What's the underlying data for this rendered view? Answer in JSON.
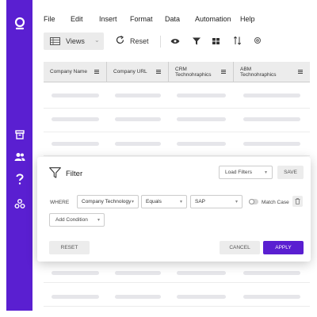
{
  "colors": {
    "brand": "#5a1fd1",
    "header_bg": "#ececec",
    "skeleton": "#e6e6ea"
  },
  "sidebar": {
    "logo_icon": "logo-icon",
    "items": [
      {
        "icon": "archive-icon"
      },
      {
        "icon": "users-icon"
      },
      {
        "icon": "help-icon"
      },
      {
        "icon": "integrations-icon"
      }
    ]
  },
  "menu": [
    "File",
    "Edit",
    "Insert",
    "Format",
    "Data",
    "Automation",
    "Help"
  ],
  "toolbar": {
    "views_label": "Views",
    "reset_label": "Reset",
    "icons": [
      "eye-icon",
      "filter-icon",
      "grid-icon",
      "sort-icon",
      "settings-icon"
    ]
  },
  "table": {
    "columns": [
      "Company Name",
      "Company URL",
      "CRM Technohraphics",
      "ABM Technohraphics"
    ]
  },
  "filter_panel": {
    "title": "Filter",
    "load_filters_label": "Load Filters",
    "save_label": "SAVE",
    "where_label": "WHERE",
    "condition": {
      "field": "Company Technology",
      "operator": "Equals",
      "value": "SAP"
    },
    "match_case_label": "Match Case",
    "add_condition_label": "Add Condition",
    "reset_label": "RESET",
    "cancel_label": "CANCEL",
    "apply_label": "APPLY"
  }
}
